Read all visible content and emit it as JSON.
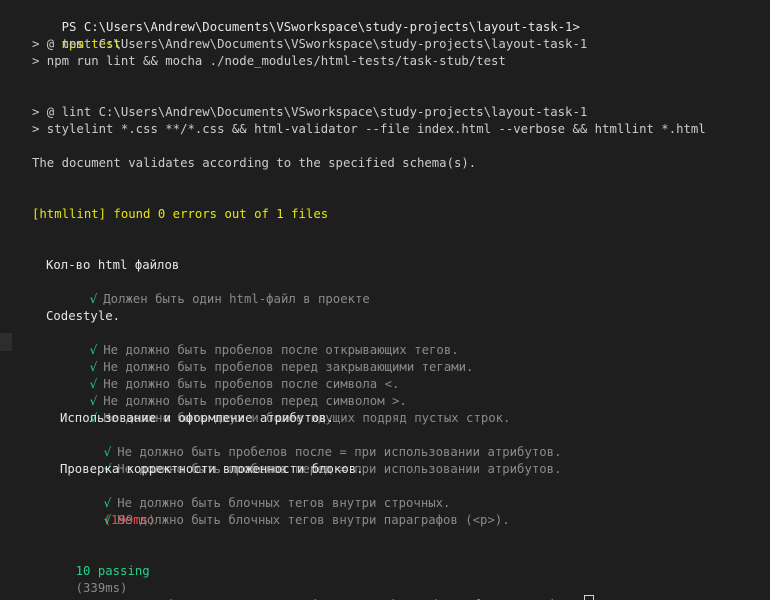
{
  "terminal": {
    "prompt_path": "PS C:\\Users\\Andrew\\Documents\\VSworkspace\\study-projects\\layout-task-1>",
    "first_command": "npm test",
    "npm_test_header": "> @ test C:\\Users\\Andrew\\Documents\\VSworkspace\\study-projects\\layout-task-1",
    "npm_test_script": "> npm run lint && mocha ./node_modules/html-tests/task-stub/test",
    "lint_header": "> @ lint C:\\Users\\Andrew\\Documents\\VSworkspace\\study-projects\\layout-task-1",
    "lint_script": "> stylelint *.css **/*.css && html-validator --file index.html --verbose && htmllint *.html",
    "validation_message": "The document validates according to the specified schema(s).",
    "htmllint_message": "[htmllint] found 0 errors out of 1 files",
    "check_symbol": "√",
    "suites": [
      {
        "title": "Кол-во html файлов",
        "tests": [
          {
            "text": "Должен быть один html-файл в проекте"
          }
        ]
      },
      {
        "title": "Codestyle.",
        "tests": [
          {
            "text": "Не должно быть пробелов после открывающих тегов."
          },
          {
            "text": "Не должно быть пробелов перед закрывающими тегами."
          },
          {
            "text": "Не должно быть пробелов после символа <."
          },
          {
            "text": "Не должно быть пробелов перед символом >."
          },
          {
            "text": "Не должно быть двух и более идущих подряд пустых строк."
          }
        ],
        "subsuites": [
          {
            "title": "Использование и оформление атрибутов.",
            "tests": [
              {
                "text": "Не должно быть пробелов после = при использовании атрибутов."
              },
              {
                "text": "Не должно быть пробелов перед = при использовании атрибутов."
              }
            ]
          },
          {
            "title": "Проверка корректности вложенности блоков.",
            "tests": [
              {
                "text": "Не должно быть блочных тегов внутри строчных.",
                "duration": "(199ms)"
              },
              {
                "text": "Не должно быть блочных тегов внутри параграфов (<p>)."
              }
            ]
          }
        ]
      }
    ],
    "passing_count": "10 passing",
    "passing_time": "(339ms)",
    "colors": {
      "background": "#1e1e1e",
      "command": "#e5e510",
      "pass": "#23d18b",
      "slow": "#f14c4c",
      "dim": "#8a8a8a"
    }
  }
}
